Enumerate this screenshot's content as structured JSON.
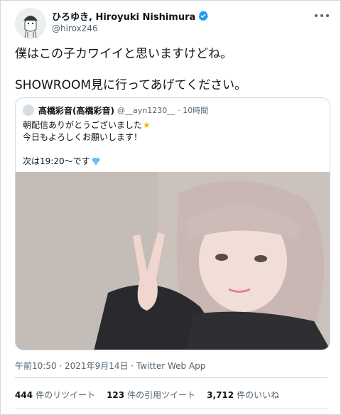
{
  "author": {
    "display_name": "ひろゆき, Hiroyuki Nishimura",
    "handle": "@hirox246",
    "verified": true
  },
  "tweet": {
    "lines": [
      "僕はこの子カワイイと思いますけどね。",
      "SHOWROOM見に行ってあげてください。"
    ]
  },
  "quote": {
    "display_name": "髙橋彩音(髙橋彩音)",
    "handle": "@__ayn1230__",
    "time": "· 10時間",
    "text_line1": "朝配信ありがとうございました",
    "text_line2": "今日もよろしくお願いします！",
    "text_line3": "次は19:20〜です",
    "icons": [
      "star-emoji",
      "diamond-emoji"
    ]
  },
  "meta": {
    "timestamp": "午前10:50 · 2021年9月14日",
    "separator": " · ",
    "source": "Twitter Web App"
  },
  "stats": {
    "retweets_count": "444",
    "retweets_label": "件のリツイート",
    "quotes_count": "123",
    "quotes_label": "件の引用ツイート",
    "likes_count": "3,712",
    "likes_label": "件のいいね"
  },
  "colors": {
    "text": "#0f1419",
    "secondary": "#536471",
    "border": "#cfd9de",
    "verified": "#1d9bf0"
  }
}
